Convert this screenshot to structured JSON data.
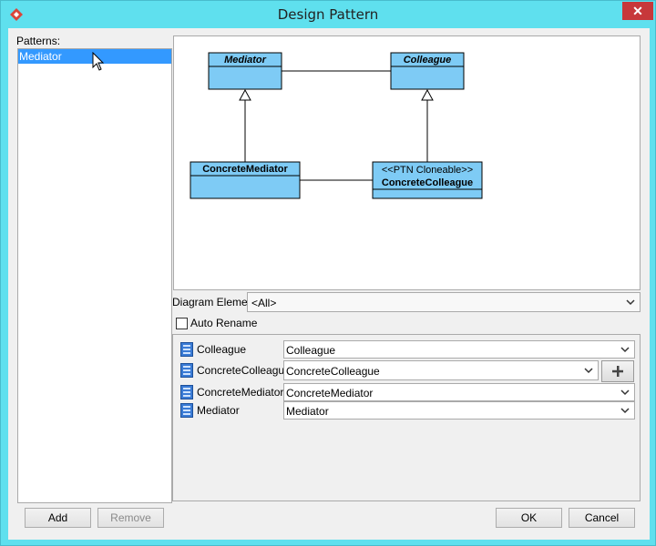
{
  "window": {
    "title": "Design Pattern",
    "close_glyph": "✕"
  },
  "patterns": {
    "label": "Patterns:",
    "items": [
      "Mediator"
    ]
  },
  "diagram": {
    "classes": {
      "mediator": {
        "name": "Mediator",
        "abstract": true
      },
      "colleague": {
        "name": "Colleague",
        "abstract": true
      },
      "concrete_mediator": {
        "name": "ConcreteMediator"
      },
      "concrete_colleague": {
        "name": "ConcreteColleague",
        "stereotype": "<<PTN Cloneable>>"
      }
    },
    "class_fill": "#7ecbf5"
  },
  "diagram_element": {
    "label": "Diagram Element",
    "value": "<All>"
  },
  "auto_rename": {
    "label": "Auto Rename",
    "checked": false
  },
  "parameters": [
    {
      "name": "Colleague",
      "value": "Colleague"
    },
    {
      "name": "ConcreteColleague",
      "value": "ConcreteColleague"
    },
    {
      "name": "ConcreteMediator",
      "value": "ConcreteMediator"
    },
    {
      "name": "Mediator",
      "value": "Mediator"
    }
  ],
  "buttons": {
    "add": "Add",
    "remove": "Remove",
    "ok": "OK",
    "cancel": "Cancel"
  }
}
